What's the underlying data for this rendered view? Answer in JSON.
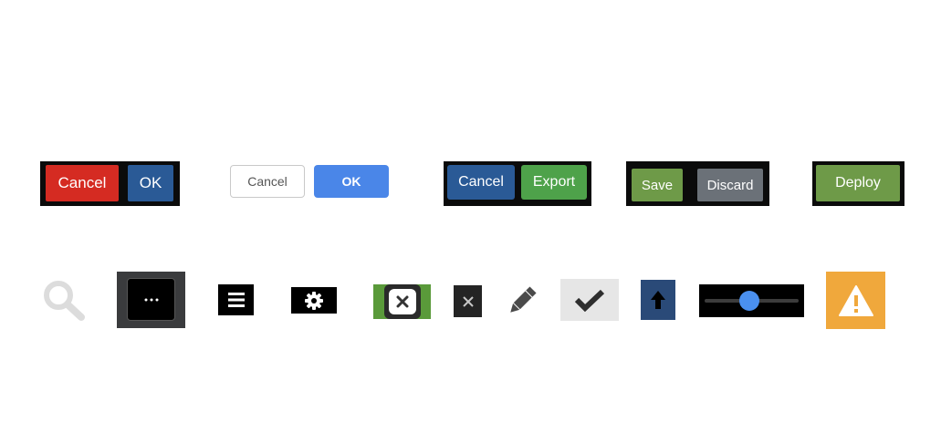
{
  "button_groups": [
    {
      "cancel_label": "Cancel",
      "ok_label": "OK"
    },
    {
      "cancel_label": "Cancel",
      "ok_label": "OK"
    },
    {
      "cancel_label": "Cancel",
      "export_label": "Export"
    },
    {
      "save_label": "Save",
      "discard_label": "Discard"
    },
    {
      "deploy_label": "Deploy"
    }
  ],
  "icons": [
    "search-icon",
    "more-options-icon",
    "menu-icon",
    "settings-icon",
    "close-icon",
    "close-icon",
    "edit-icon",
    "check-icon",
    "upload-arrow-icon",
    "slider",
    "warning-icon"
  ],
  "slider": {
    "value": 0.48
  },
  "colors": {
    "red": "#d52b22",
    "blue": "#2a5a96",
    "light_blue": "#4a86e8",
    "green": "#4ea24a",
    "olive_green": "#6e9a48",
    "gray": "#6b7178",
    "orange": "#f0a83c",
    "slider_knob": "#4a90f0"
  }
}
